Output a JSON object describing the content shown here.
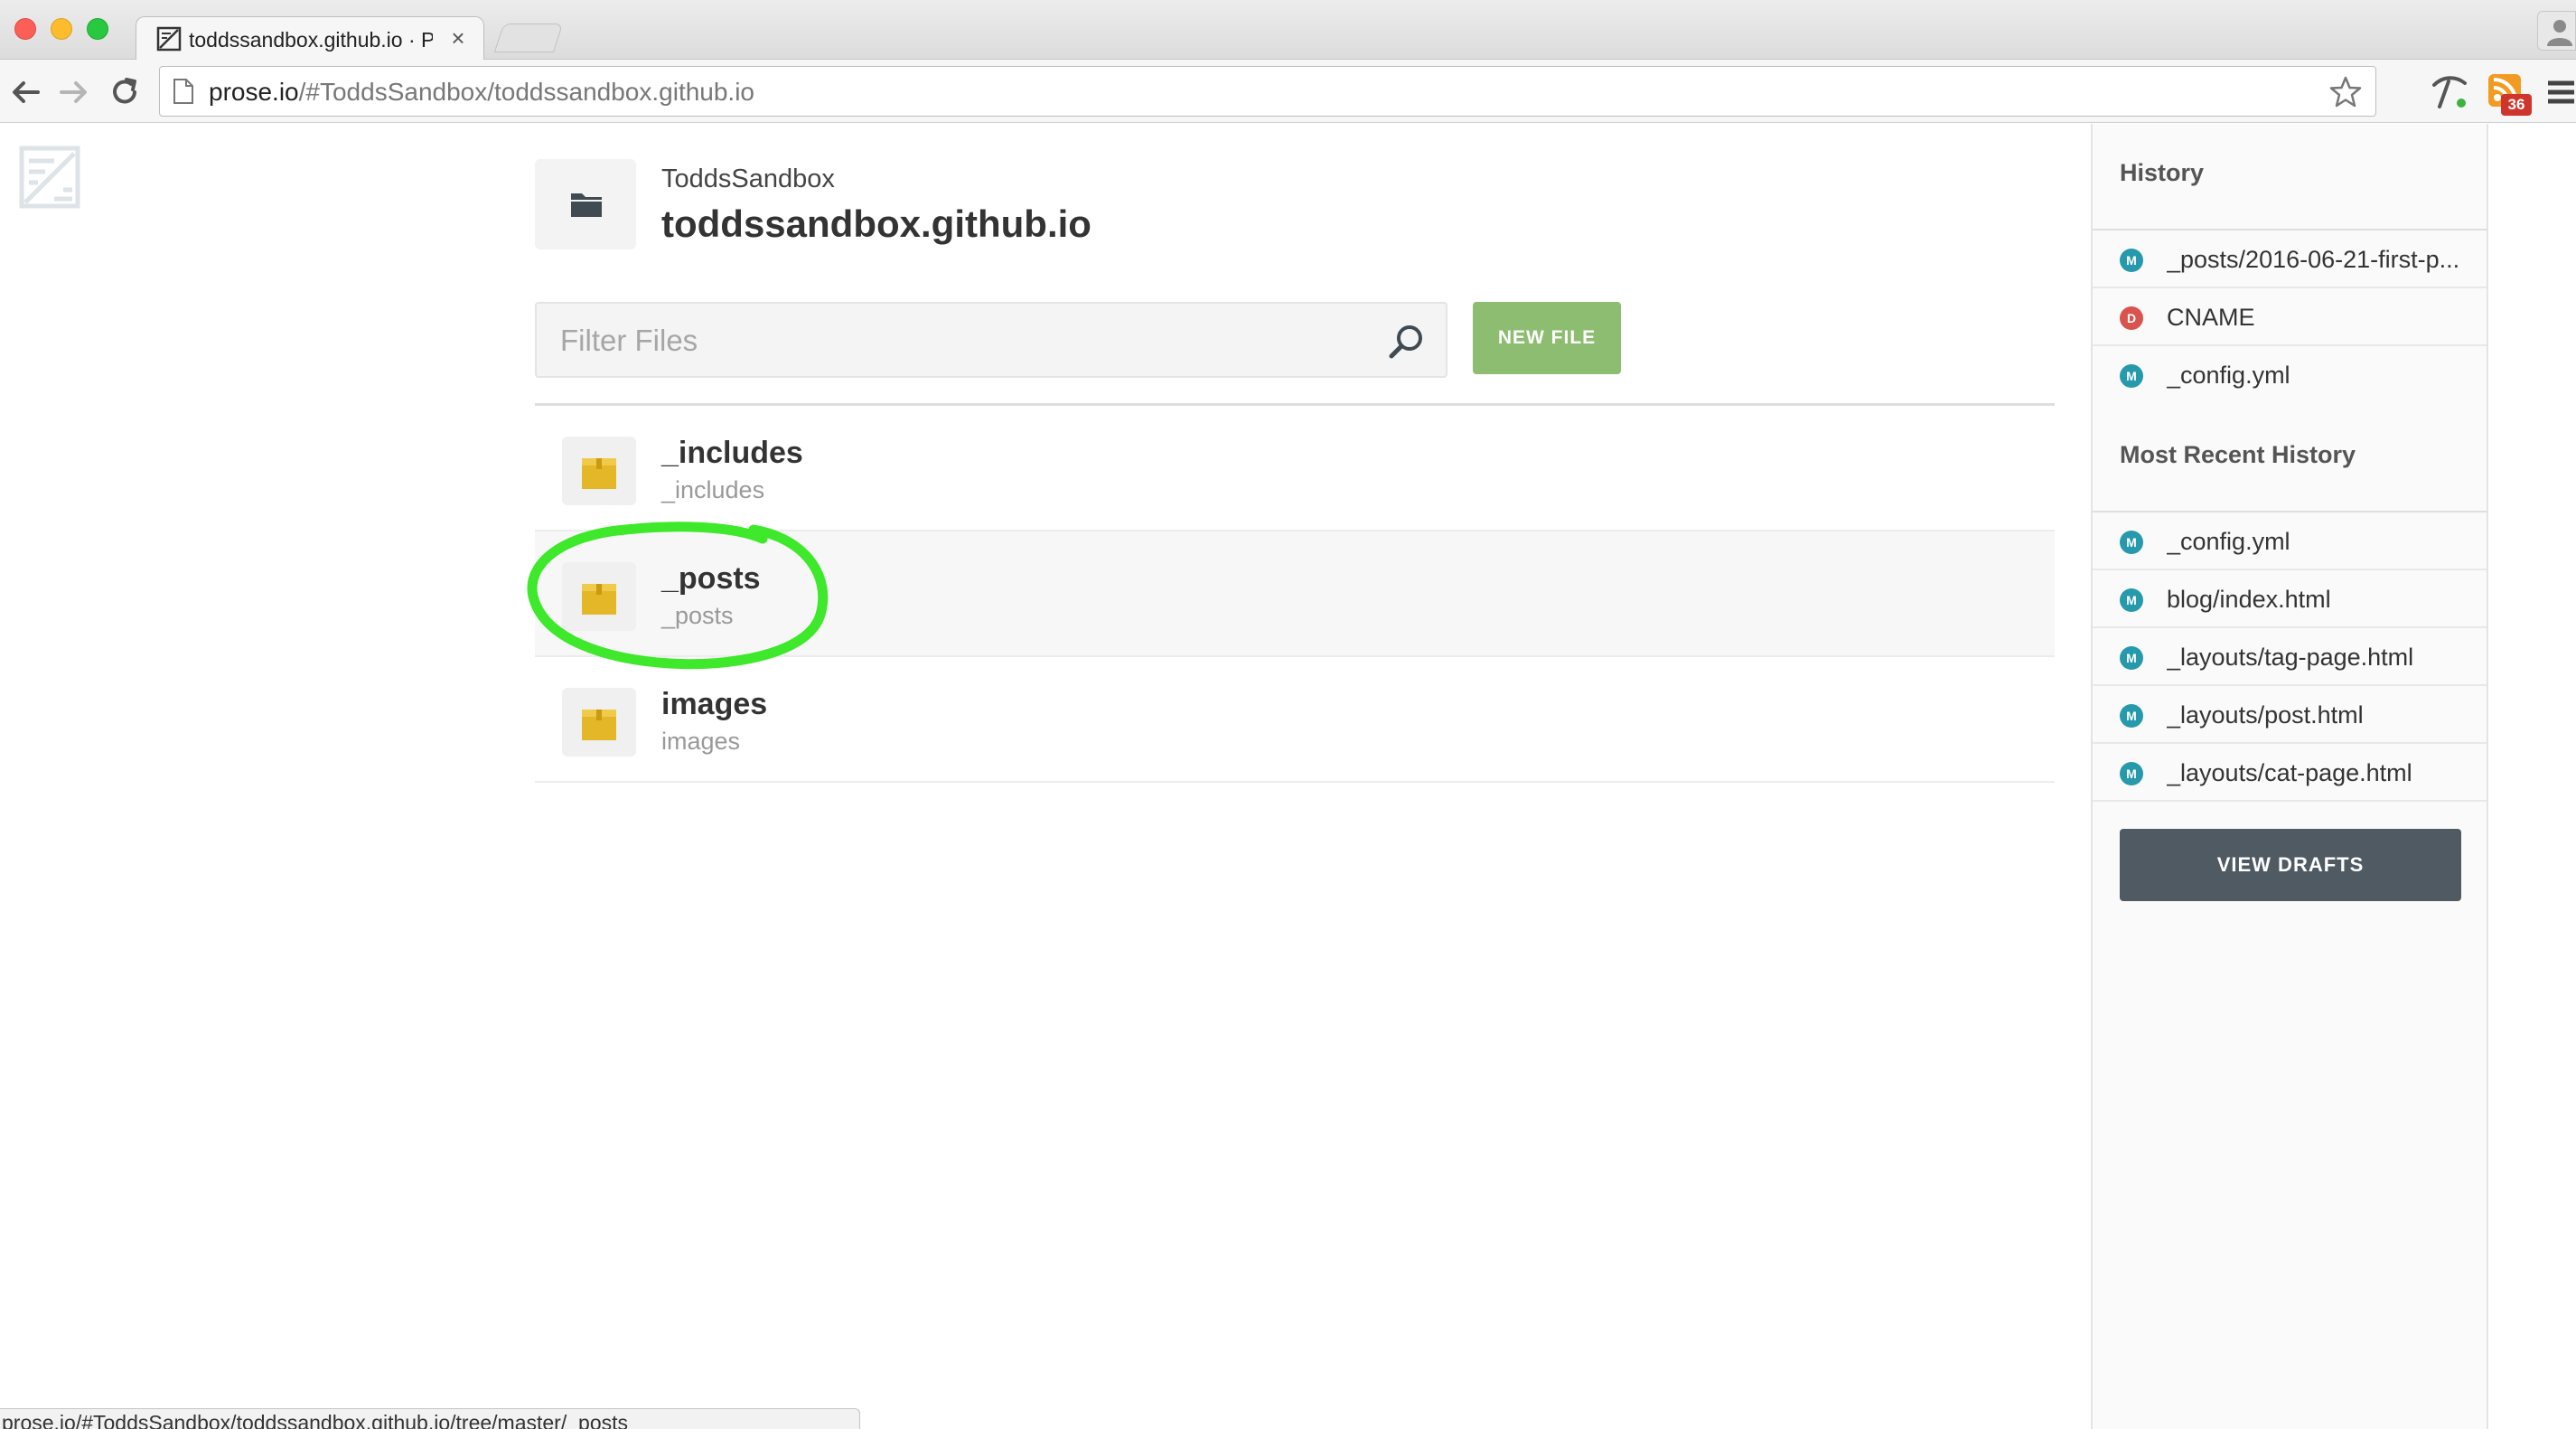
{
  "browser": {
    "tab": {
      "title": "toddssandbox.github.io · P",
      "close": "×"
    },
    "address_bar": {
      "url_host": "prose.io",
      "url_path": "/#ToddsSandbox/toddssandbox.github.io"
    },
    "extension_badge": "36",
    "status_url": "prose.io/#ToddsSandbox/toddssandbox.github.io/tree/master/_posts"
  },
  "repo": {
    "owner": "ToddsSandbox",
    "name": "toddssandbox.github.io"
  },
  "filter": {
    "placeholder": "Filter Files",
    "value": ""
  },
  "actions": {
    "new_file_label": "NEW FILE",
    "view_drafts_label": "VIEW DRAFTS"
  },
  "files": [
    {
      "name": "_includes",
      "path": "_includes",
      "type": "folder"
    },
    {
      "name": "_posts",
      "path": "_posts",
      "type": "folder"
    },
    {
      "name": "images",
      "path": "images",
      "type": "folder"
    }
  ],
  "sidebar": {
    "history_title": "History",
    "history": [
      {
        "status": "M",
        "label": "_posts/2016-06-21-first-p..."
      },
      {
        "status": "D",
        "label": "CNAME"
      },
      {
        "status": "M",
        "label": "_config.yml"
      }
    ],
    "recent_title": "Most Recent History",
    "recent": [
      {
        "status": "M",
        "label": "_config.yml"
      },
      {
        "status": "M",
        "label": "blog/index.html"
      },
      {
        "status": "M",
        "label": "_layouts/tag-page.html"
      },
      {
        "status": "M",
        "label": "_layouts/post.html"
      },
      {
        "status": "M",
        "label": "_layouts/cat-page.html"
      }
    ]
  },
  "colors": {
    "new_file_button": "#8dbd71",
    "view_drafts_button": "#4f5a63",
    "folder_icon": "#e3b727",
    "modified_badge": "#2799ac",
    "deleted_badge": "#d9534f",
    "highlight_annotation": "#3ee82a"
  },
  "icons": {
    "tab_favicon": "prose-logo-icon",
    "back": "arrow-left-icon",
    "forward": "arrow-right-icon",
    "reload": "reload-icon",
    "page": "page-icon",
    "bookmark": "star-icon",
    "extension_1": "pickaxe-icon",
    "extension_2": "rss-icon",
    "menu": "hamburger-menu-icon",
    "repo": "folder-icon",
    "search": "search-icon",
    "file_row": "box-folder-icon"
  }
}
